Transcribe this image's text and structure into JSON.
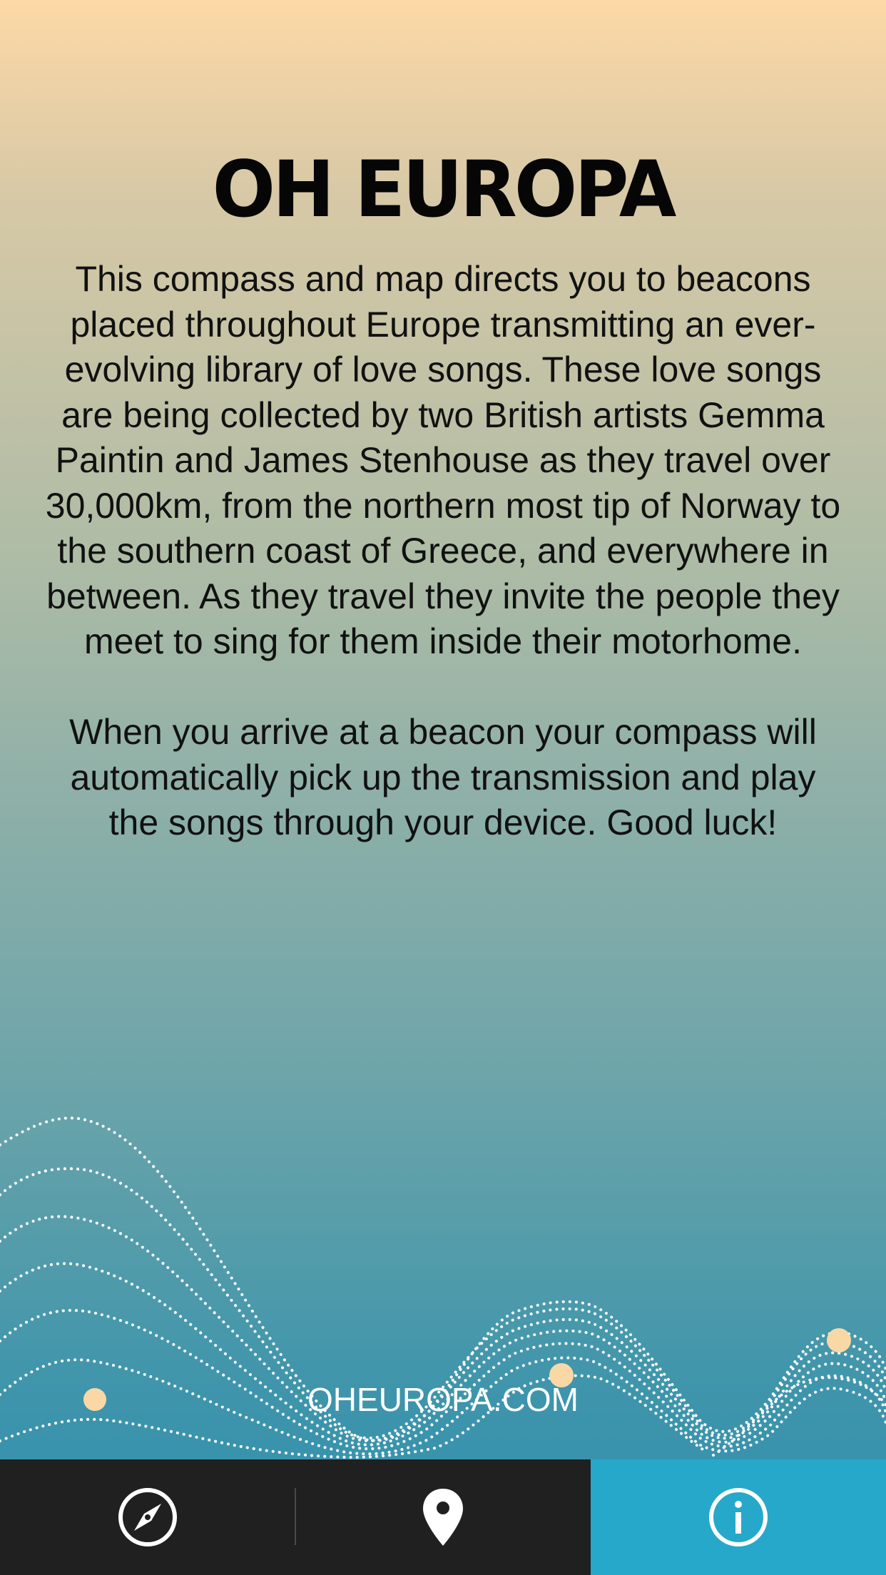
{
  "header": {
    "title": "OH EUROPA"
  },
  "about": {
    "paragraphs": [
      "This compass and map directs you to beacons placed throughout Europe transmitting an ever-evolving library of love songs. These love songs are being collected by two British artists Gemma Paintin and James Stenhouse as they travel over 30,000km, from the northern most tip of Norway to the southern coast of Greece, and everywhere in between. As they travel they invite the people they meet to sing for them inside their motorhome.",
      "When you arrive at a beacon your compass will automatically pick up the transmission and play the songs through your device. Good luck!"
    ]
  },
  "footer": {
    "link": "OHEUROPA.COM"
  },
  "tabs": [
    {
      "id": "compass",
      "icon": "compass-icon",
      "active": false
    },
    {
      "id": "map",
      "icon": "map-pin-icon",
      "active": false
    },
    {
      "id": "info",
      "icon": "info-icon",
      "active": true
    }
  ],
  "colors": {
    "gradient_top": "#fdd9a6",
    "gradient_bottom": "#2f8fae",
    "tabbar_bg": "#202020",
    "active_tab": "#26a8cb",
    "beacon_dot": "#fad8a6",
    "text": "#060606"
  }
}
